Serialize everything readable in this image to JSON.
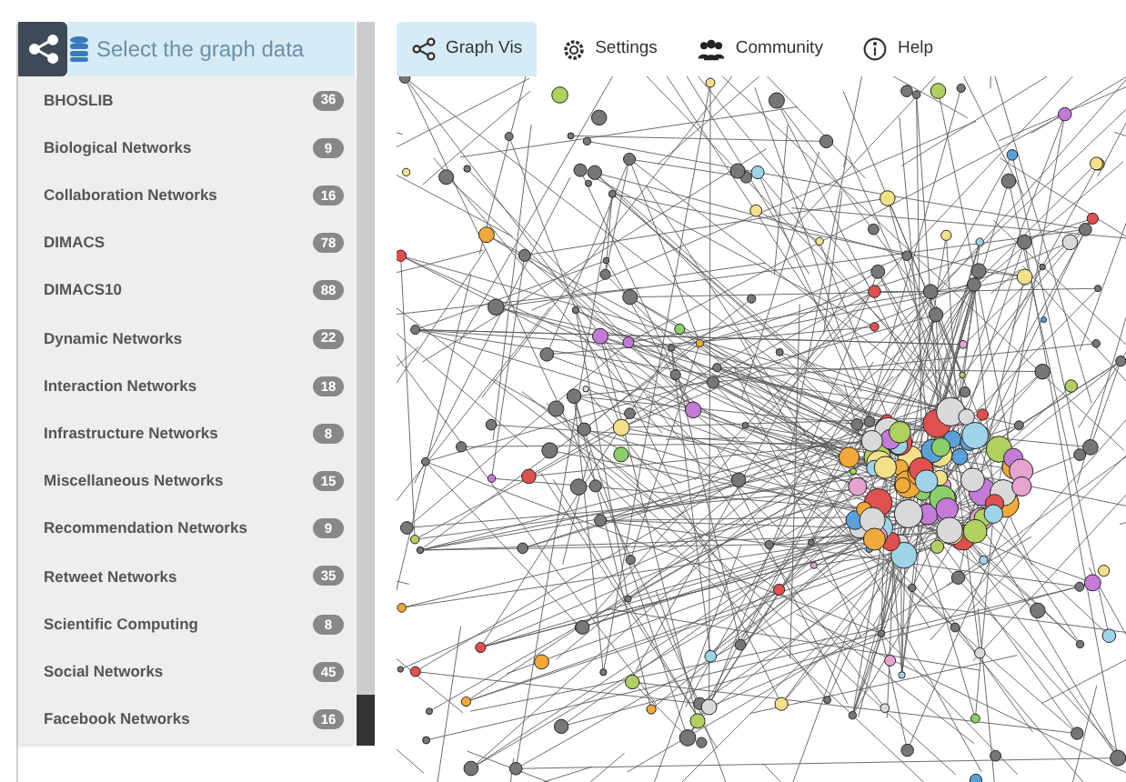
{
  "sidebar": {
    "header": {
      "label": "Select the graph data"
    },
    "items": [
      {
        "label": "BHOSLIB",
        "count": "36"
      },
      {
        "label": "Biological Networks",
        "count": "9"
      },
      {
        "label": "Collaboration Networks",
        "count": "16"
      },
      {
        "label": "DIMACS",
        "count": "78"
      },
      {
        "label": "DIMACS10",
        "count": "88"
      },
      {
        "label": "Dynamic Networks",
        "count": "22"
      },
      {
        "label": "Interaction Networks",
        "count": "18"
      },
      {
        "label": "Infrastructure Networks",
        "count": "8"
      },
      {
        "label": "Miscellaneous Networks",
        "count": "15"
      },
      {
        "label": "Recommendation Networks",
        "count": "9"
      },
      {
        "label": "Retweet Networks",
        "count": "35"
      },
      {
        "label": "Scientific Computing",
        "count": "8"
      },
      {
        "label": "Social Networks",
        "count": "45"
      },
      {
        "label": "Facebook Networks",
        "count": "16"
      }
    ]
  },
  "tabs": [
    {
      "label": "Graph Vis",
      "kind": "share",
      "selected": true
    },
    {
      "label": "Settings",
      "kind": "gear",
      "selected": false
    },
    {
      "label": "Community",
      "kind": "users",
      "selected": false
    },
    {
      "label": "Help",
      "kind": "info",
      "selected": false
    }
  ]
}
